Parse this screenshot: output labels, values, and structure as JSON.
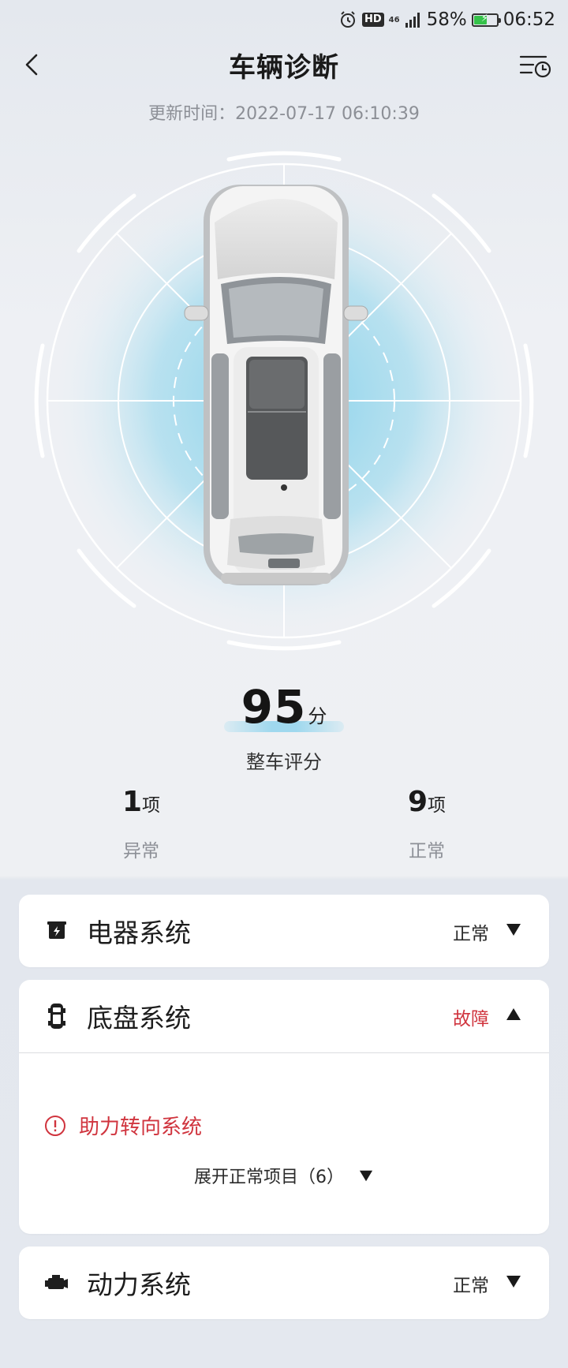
{
  "status_bar": {
    "network": "46",
    "hd": "HD",
    "battery_percent": "58%",
    "battery_level": 0.58,
    "battery_charging": true,
    "time": "06:52",
    "icons": [
      "alarm-icon",
      "hd-icon",
      "signal-icon",
      "battery-icon"
    ]
  },
  "header": {
    "title": "车辆诊断",
    "back_icon": "chevron-left-icon",
    "history_icon": "history-list-icon"
  },
  "update_time": "更新时间：2022-07-17 06:10:39",
  "score": {
    "value": "95",
    "unit": "分",
    "label": "整车评分"
  },
  "stats": {
    "abnormal": {
      "count": "1",
      "unit": "项",
      "label": "异常"
    },
    "normal": {
      "count": "9",
      "unit": "项",
      "label": "正常"
    }
  },
  "systems": [
    {
      "name": "电器系统",
      "status": "正常",
      "state": "normal",
      "expanded": false,
      "icon": "electrical-icon"
    },
    {
      "name": "底盘系统",
      "status": "故障",
      "state": "fault",
      "expanded": true,
      "icon": "chassis-icon",
      "fault_items": [
        "助力转向系统"
      ],
      "expand_label": "展开正常项目（6）"
    },
    {
      "name": "动力系统",
      "status": "正常",
      "state": "normal",
      "expanded": false,
      "icon": "engine-icon"
    }
  ],
  "colors": {
    "fault": "#d0343e",
    "accent_glow": "#9fd8ee",
    "background": "#eef0f4"
  }
}
